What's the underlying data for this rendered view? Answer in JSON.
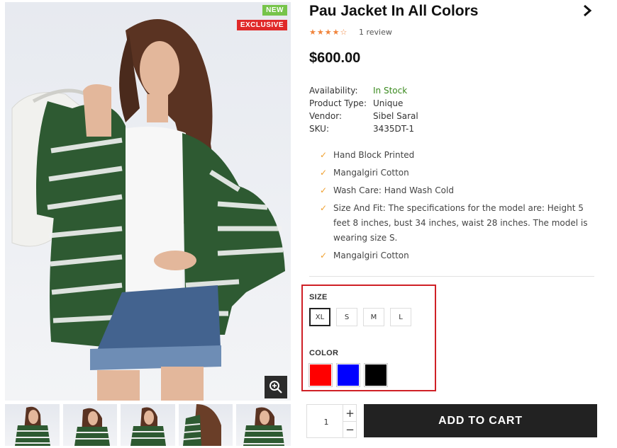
{
  "gallery": {
    "badges": {
      "new": "NEW",
      "exclusive": "EXCLUSIVE"
    },
    "zoom_icon": "zoom-in-icon",
    "thumbnail_count": 5
  },
  "product": {
    "title": "Pau Jacket In All Colors",
    "rating": 4,
    "rating_max": 5,
    "review_text": "1 review",
    "price": "$600.00",
    "details": [
      {
        "label": "Availability:",
        "value": "In Stock"
      },
      {
        "label": "Product Type:",
        "value": "Unique"
      },
      {
        "label": "Vendor:",
        "value": "Sibel Saral"
      },
      {
        "label": "SKU:",
        "value": "3435DT-1"
      }
    ],
    "features": [
      "Hand Block Printed",
      "Mangalgiri Cotton",
      "Wash Care: Hand Wash Cold",
      "Size And Fit: The specifications for the model are: Height 5 feet 8 inches, bust 34 inches, waist 28 inches. The model is wearing size S.",
      "Mangalgiri Cotton"
    ]
  },
  "options": {
    "size_label": "SIZE",
    "sizes": [
      "XL",
      "S",
      "M",
      "L"
    ],
    "selected_size": "XL",
    "color_label": "COLOR",
    "colors": [
      "#ff0000",
      "#0000ff",
      "#000000"
    ]
  },
  "cart": {
    "quantity": "1",
    "plus": "+",
    "minus": "−",
    "button_label": "ADD TO CART"
  },
  "colors": {
    "star": "#f0843c",
    "in_stock": "#3a8a1e",
    "check": "#f0a030",
    "highlight": "#cf2026",
    "button_bg": "#222222"
  }
}
